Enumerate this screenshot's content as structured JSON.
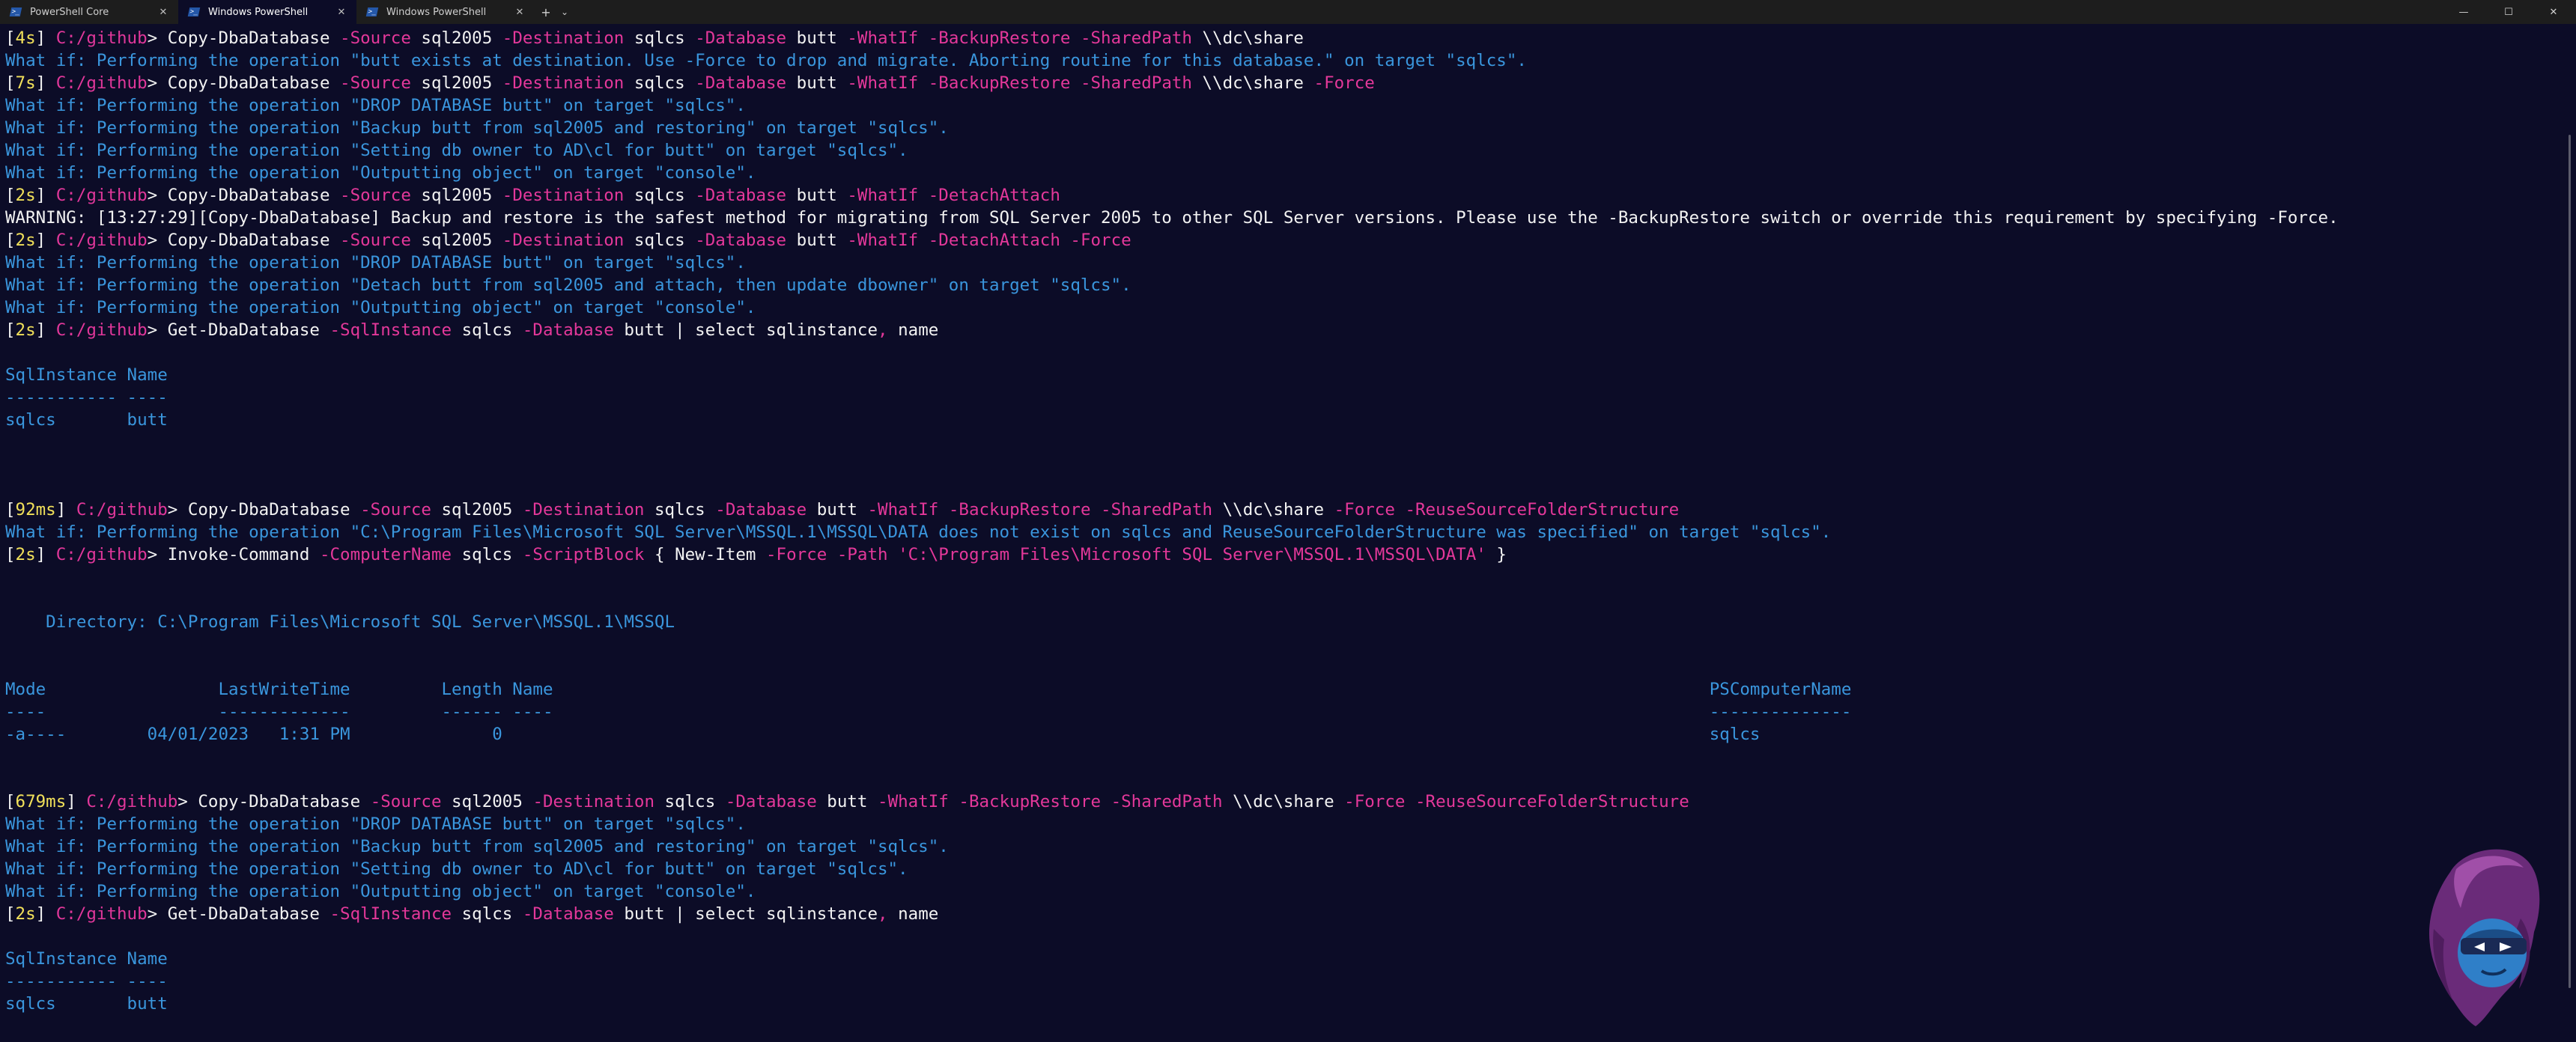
{
  "window": {
    "tabs": [
      {
        "title": "PowerShell Core",
        "active": false
      },
      {
        "title": "Windows PowerShell",
        "active": true
      },
      {
        "title": "Windows PowerShell",
        "active": false
      }
    ],
    "new_tab_label": "+",
    "dropdown_label": "⌄",
    "controls": {
      "minimize": "—",
      "maximize": "☐",
      "close": "✕"
    }
  },
  "colors": {
    "background": "#0c0c27",
    "timing": "#f1e05a",
    "path": "#e0379a",
    "parameter": "#e4389a",
    "output": "#3a96dd",
    "text": "#f2f2f2"
  },
  "terminal": {
    "lines": [
      [
        [
          "br",
          "["
        ],
        [
          "tm",
          "4s"
        ],
        [
          "br",
          "] "
        ],
        [
          "path",
          "C:/github"
        ],
        [
          "br",
          "> Copy-DbaDatabase "
        ],
        [
          "prm",
          "-Source"
        ],
        [
          "br",
          " sql2005 "
        ],
        [
          "prm",
          "-Destination"
        ],
        [
          "br",
          " sqlcs "
        ],
        [
          "prm",
          "-Database"
        ],
        [
          "br",
          " butt "
        ],
        [
          "prm",
          "-WhatIf -BackupRestore -SharedPath"
        ],
        [
          "br",
          " \\\\dc\\share"
        ]
      ],
      [
        [
          "cyn",
          "What if: Performing the operation \"butt exists at destination. Use -Force to drop and migrate. Aborting routine for this database.\" on target \"sqlcs\"."
        ]
      ],
      [
        [
          "br",
          "["
        ],
        [
          "tm",
          "7s"
        ],
        [
          "br",
          "] "
        ],
        [
          "path",
          "C:/github"
        ],
        [
          "br",
          "> Copy-DbaDatabase "
        ],
        [
          "prm",
          "-Source"
        ],
        [
          "br",
          " sql2005 "
        ],
        [
          "prm",
          "-Destination"
        ],
        [
          "br",
          " sqlcs "
        ],
        [
          "prm",
          "-Database"
        ],
        [
          "br",
          " butt "
        ],
        [
          "prm",
          "-WhatIf -BackupRestore -SharedPath"
        ],
        [
          "br",
          " \\\\dc\\share "
        ],
        [
          "prm",
          "-Force"
        ]
      ],
      [
        [
          "cyn",
          "What if: Performing the operation \"DROP DATABASE butt\" on target \"sqlcs\"."
        ]
      ],
      [
        [
          "cyn",
          "What if: Performing the operation \"Backup butt from sql2005 and restoring\" on target \"sqlcs\"."
        ]
      ],
      [
        [
          "cyn",
          "What if: Performing the operation \"Setting db owner to AD\\cl for butt\" on target \"sqlcs\"."
        ]
      ],
      [
        [
          "cyn",
          "What if: Performing the operation \"Outputting object\" on target \"console\"."
        ]
      ],
      [
        [
          "br",
          "["
        ],
        [
          "tm",
          "2s"
        ],
        [
          "br",
          "] "
        ],
        [
          "path",
          "C:/github"
        ],
        [
          "br",
          "> Copy-DbaDatabase "
        ],
        [
          "prm",
          "-Source"
        ],
        [
          "br",
          " sql2005 "
        ],
        [
          "prm",
          "-Destination"
        ],
        [
          "br",
          " sqlcs "
        ],
        [
          "prm",
          "-Database"
        ],
        [
          "br",
          " butt "
        ],
        [
          "prm",
          "-WhatIf -DetachAttach"
        ]
      ],
      [
        [
          "br",
          "WARNING: [13:27:29][Copy-DbaDatabase] Backup and restore is the safest method for migrating from SQL Server 2005 to other SQL Server versions. Please use the -BackupRestore switch or override this requirement by specifying -Force."
        ]
      ],
      [
        [
          "br",
          "["
        ],
        [
          "tm",
          "2s"
        ],
        [
          "br",
          "] "
        ],
        [
          "path",
          "C:/github"
        ],
        [
          "br",
          "> Copy-DbaDatabase "
        ],
        [
          "prm",
          "-Source"
        ],
        [
          "br",
          " sql2005 "
        ],
        [
          "prm",
          "-Destination"
        ],
        [
          "br",
          " sqlcs "
        ],
        [
          "prm",
          "-Database"
        ],
        [
          "br",
          " butt "
        ],
        [
          "prm",
          "-WhatIf -DetachAttach -Force"
        ]
      ],
      [
        [
          "cyn",
          "What if: Performing the operation \"DROP DATABASE butt\" on target \"sqlcs\"."
        ]
      ],
      [
        [
          "cyn",
          "What if: Performing the operation \"Detach butt from sql2005 and attach, then update dbowner\" on target \"sqlcs\"."
        ]
      ],
      [
        [
          "cyn",
          "What if: Performing the operation \"Outputting object\" on target \"console\"."
        ]
      ],
      [
        [
          "br",
          "["
        ],
        [
          "tm",
          "2s"
        ],
        [
          "br",
          "] "
        ],
        [
          "path",
          "C:/github"
        ],
        [
          "br",
          "> Get-DbaDatabase "
        ],
        [
          "prm",
          "-SqlInstance"
        ],
        [
          "br",
          " sqlcs "
        ],
        [
          "prm",
          "-Database"
        ],
        [
          "br",
          " butt | select sqlinstance"
        ],
        [
          "prm",
          ","
        ],
        [
          "br",
          " name"
        ]
      ],
      [],
      [
        [
          "cyn",
          "SqlInstance Name"
        ]
      ],
      [
        [
          "cyn",
          "----------- ----"
        ]
      ],
      [
        [
          "cyn",
          "sqlcs       butt"
        ]
      ],
      [],
      [],
      [],
      [
        [
          "br",
          "["
        ],
        [
          "tm",
          "92ms"
        ],
        [
          "br",
          "] "
        ],
        [
          "path",
          "C:/github"
        ],
        [
          "br",
          "> Copy-DbaDatabase "
        ],
        [
          "prm",
          "-Source"
        ],
        [
          "br",
          " sql2005 "
        ],
        [
          "prm",
          "-Destination"
        ],
        [
          "br",
          " sqlcs "
        ],
        [
          "prm",
          "-Database"
        ],
        [
          "br",
          " butt "
        ],
        [
          "prm",
          "-WhatIf -BackupRestore -SharedPath"
        ],
        [
          "br",
          " \\\\dc\\share "
        ],
        [
          "prm",
          "-Force -ReuseSourceFolderStructure"
        ]
      ],
      [
        [
          "cyn",
          "What if: Performing the operation \"C:\\Program Files\\Microsoft SQL Server\\MSSQL.1\\MSSQL\\DATA does not exist on sqlcs and ReuseSourceFolderStructure was specified\" on target \"sqlcs\"."
        ]
      ],
      [
        [
          "br",
          "["
        ],
        [
          "tm",
          "2s"
        ],
        [
          "br",
          "] "
        ],
        [
          "path",
          "C:/github"
        ],
        [
          "br",
          "> Invoke-Command "
        ],
        [
          "prm",
          "-ComputerName"
        ],
        [
          "br",
          " sqlcs "
        ],
        [
          "prm",
          "-ScriptBlock"
        ],
        [
          "br",
          " { New-Item "
        ],
        [
          "prm",
          "-Force -Path"
        ],
        [
          "br",
          " "
        ],
        [
          "prm",
          "'C:\\Program Files\\Microsoft SQL Server\\MSSQL.1\\MSSQL\\DATA'"
        ],
        [
          "br",
          " }"
        ]
      ],
      [],
      [],
      [
        [
          "cyn",
          "    Directory: C:\\Program Files\\Microsoft SQL Server\\MSSQL.1\\MSSQL"
        ]
      ],
      [],
      [],
      [
        [
          "cyn",
          "Mode                 LastWriteTime         Length Name                                                                                                                  PSComputerName"
        ]
      ],
      [
        [
          "cyn",
          "----                 -------------         ------ ----                                                                                                                  --------------"
        ]
      ],
      [
        [
          "cyn",
          "-a----        04/01/2023   1:31 PM              0                                                                                                                       sqlcs"
        ]
      ],
      [],
      [],
      [
        [
          "br",
          "["
        ],
        [
          "tm",
          "679ms"
        ],
        [
          "br",
          "] "
        ],
        [
          "path",
          "C:/github"
        ],
        [
          "br",
          "> Copy-DbaDatabase "
        ],
        [
          "prm",
          "-Source"
        ],
        [
          "br",
          " sql2005 "
        ],
        [
          "prm",
          "-Destination"
        ],
        [
          "br",
          " sqlcs "
        ],
        [
          "prm",
          "-Database"
        ],
        [
          "br",
          " butt "
        ],
        [
          "prm",
          "-WhatIf -BackupRestore -SharedPath"
        ],
        [
          "br",
          " \\\\dc\\share "
        ],
        [
          "prm",
          "-Force -ReuseSourceFolderStructure"
        ]
      ],
      [
        [
          "cyn",
          "What if: Performing the operation \"DROP DATABASE butt\" on target \"sqlcs\"."
        ]
      ],
      [
        [
          "cyn",
          "What if: Performing the operation \"Backup butt from sql2005 and restoring\" on target \"sqlcs\"."
        ]
      ],
      [
        [
          "cyn",
          "What if: Performing the operation \"Setting db owner to AD\\cl for butt\" on target \"sqlcs\"."
        ]
      ],
      [
        [
          "cyn",
          "What if: Performing the operation \"Outputting object\" on target \"console\"."
        ]
      ],
      [
        [
          "br",
          "["
        ],
        [
          "tm",
          "2s"
        ],
        [
          "br",
          "] "
        ],
        [
          "path",
          "C:/github"
        ],
        [
          "br",
          "> Get-DbaDatabase "
        ],
        [
          "prm",
          "-SqlInstance"
        ],
        [
          "br",
          " sqlcs "
        ],
        [
          "prm",
          "-Database"
        ],
        [
          "br",
          " butt | select sqlinstance"
        ],
        [
          "prm",
          ","
        ],
        [
          "br",
          " name"
        ]
      ],
      [],
      [
        [
          "cyn",
          "SqlInstance Name"
        ]
      ],
      [
        [
          "cyn",
          "----------- ----"
        ]
      ],
      [
        [
          "cyn",
          "sqlcs       butt"
        ]
      ]
    ]
  }
}
